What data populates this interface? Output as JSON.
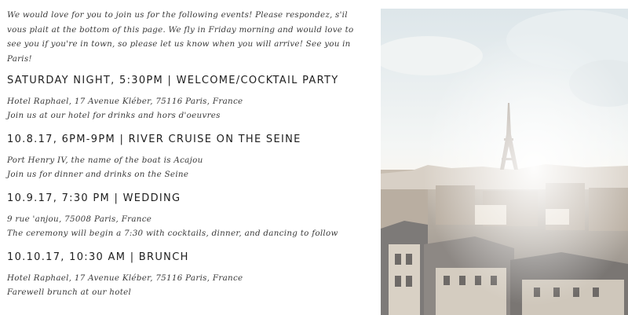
{
  "intro": "We would love for you to join us for the following events! Please respondez, s'il vous plait at the bottom of this page. We fly in Friday morning and would love to see you if you're in town, so please let us know when you will arrive! See you in Paris!",
  "events": [
    {
      "heading": "SATURDAY NIGHT, 5:30PM | WELCOME/COCKTAIL PARTY",
      "line1": "Hotel Raphael, 17 Avenue Kléber, 75116 Paris, France",
      "line2": "Join us at our hotel for drinks and hors d'oeuvres"
    },
    {
      "heading": "10.8.17, 6PM-9PM | RIVER CRUISE ON THE SEINE",
      "line1": "Port Henry IV, the name of the boat is Acajou",
      "line2": "Join us for dinner and drinks on the Seine"
    },
    {
      "heading": "10.9.17, 7:30 PM | WEDDING",
      "line1": "9 rue 'anjou, 75008 Paris, France",
      "line2": "The ceremony will begin a 7:30 with cocktails, dinner, and dancing to follow"
    },
    {
      "heading": "10.10.17, 10:30 AM | BRUNCH",
      "line1": "Hotel Raphael, 17 Avenue Kléber, 75116 Paris, France",
      "line2": "Farewell brunch at our hotel"
    }
  ],
  "photo": {
    "subject": "eiffel-tower-paris-rooftops"
  }
}
